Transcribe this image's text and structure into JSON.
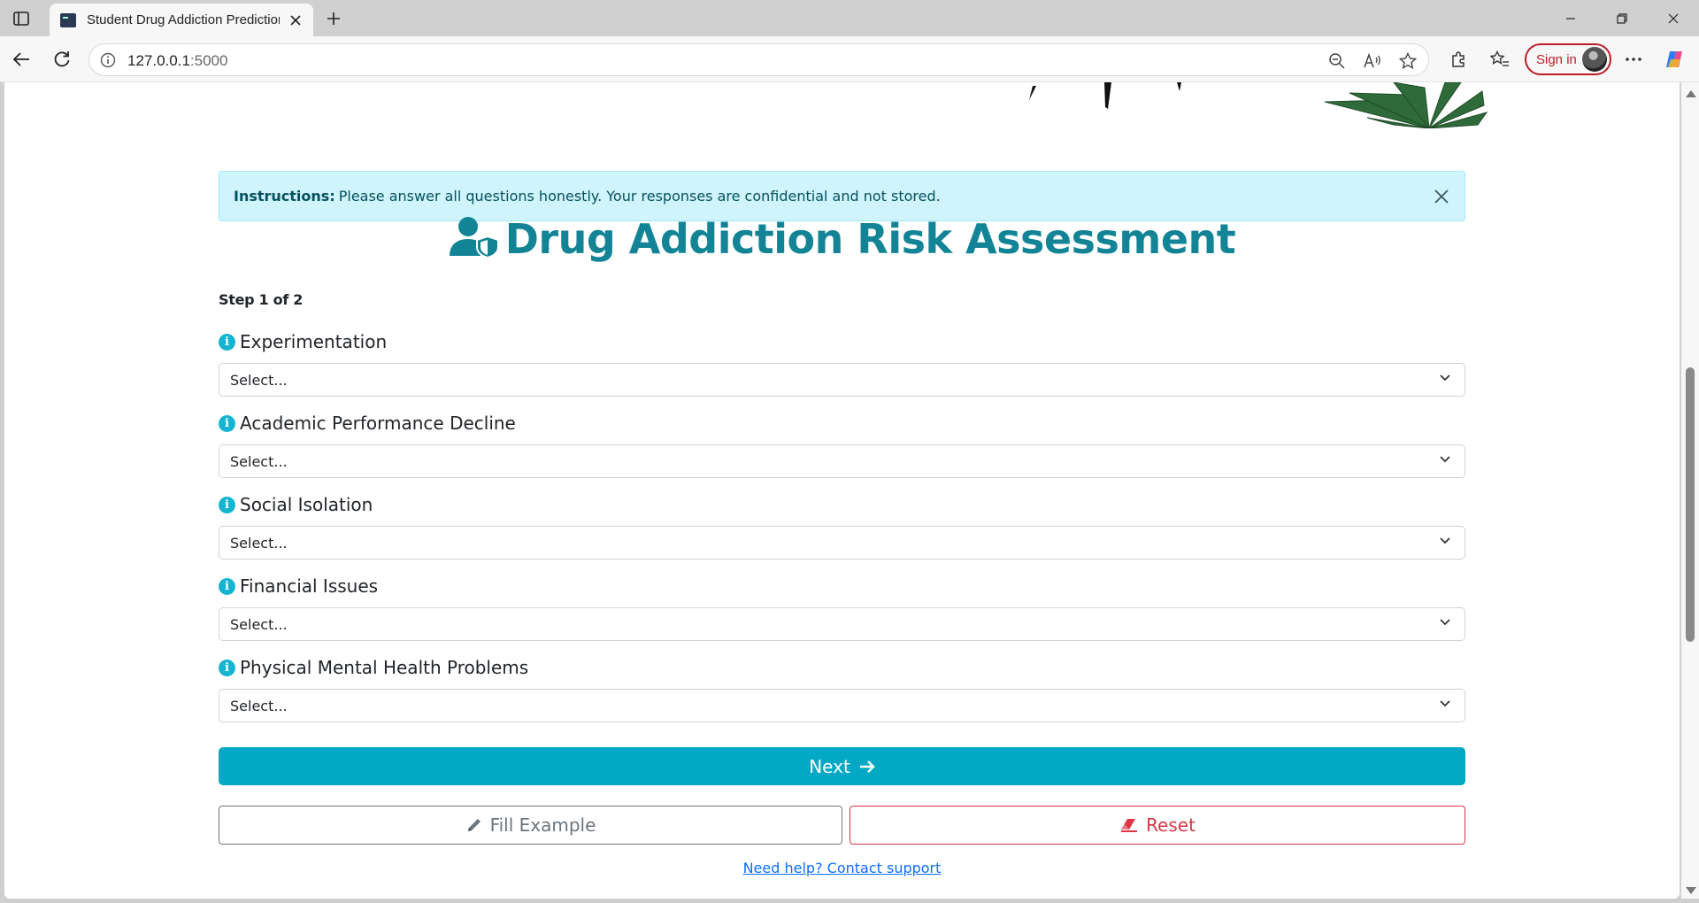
{
  "browser": {
    "tab_title": "Student Drug Addiction Prediction",
    "url_host": "127.0.0.1",
    "url_port": ":5000",
    "signin_label": "Sign in"
  },
  "alert": {
    "strong": "Instructions:",
    "text": "Please answer all questions honestly. Your responses are confidential and not stored."
  },
  "page": {
    "title": "Drug Addiction Risk Assessment",
    "step": "Step 1 of 2"
  },
  "fields": [
    {
      "label": "Experimentation",
      "value": "Select..."
    },
    {
      "label": "Academic Performance Decline",
      "value": "Select..."
    },
    {
      "label": "Social Isolation",
      "value": "Select..."
    },
    {
      "label": "Financial Issues",
      "value": "Select..."
    },
    {
      "label": "Physical Mental Health Problems",
      "value": "Select..."
    }
  ],
  "buttons": {
    "next": "Next",
    "fill_example": "Fill Example",
    "reset": "Reset"
  },
  "help_link": "Need help? Contact support",
  "colors": {
    "primary": "#03a9c4",
    "title": "#138496",
    "alert_bg": "#cff4fc",
    "danger": "#dc3545",
    "secondary": "#6c757d",
    "link": "#0d6efd"
  }
}
